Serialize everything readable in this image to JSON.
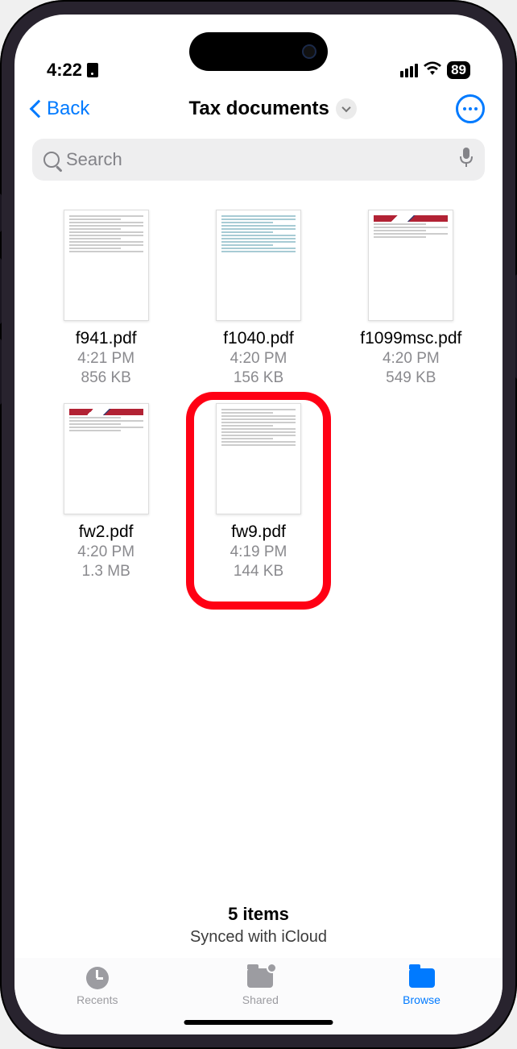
{
  "status": {
    "time": "4:22",
    "battery": "89"
  },
  "nav": {
    "back": "Back",
    "title": "Tax documents"
  },
  "search": {
    "placeholder": "Search"
  },
  "files": [
    {
      "name": "f941.pdf",
      "time": "4:21 PM",
      "size": "856 KB"
    },
    {
      "name": "f1040.pdf",
      "time": "4:20 PM",
      "size": "156 KB"
    },
    {
      "name": "f1099msc.pdf",
      "time": "4:20 PM",
      "size": "549 KB"
    },
    {
      "name": "fw2.pdf",
      "time": "4:20 PM",
      "size": "1.3 MB"
    },
    {
      "name": "fw9.pdf",
      "time": "4:19 PM",
      "size": "144 KB"
    }
  ],
  "summary": {
    "count": "5 items",
    "sync": "Synced with iCloud"
  },
  "tabs": {
    "recents": "Recents",
    "shared": "Shared",
    "browse": "Browse"
  }
}
